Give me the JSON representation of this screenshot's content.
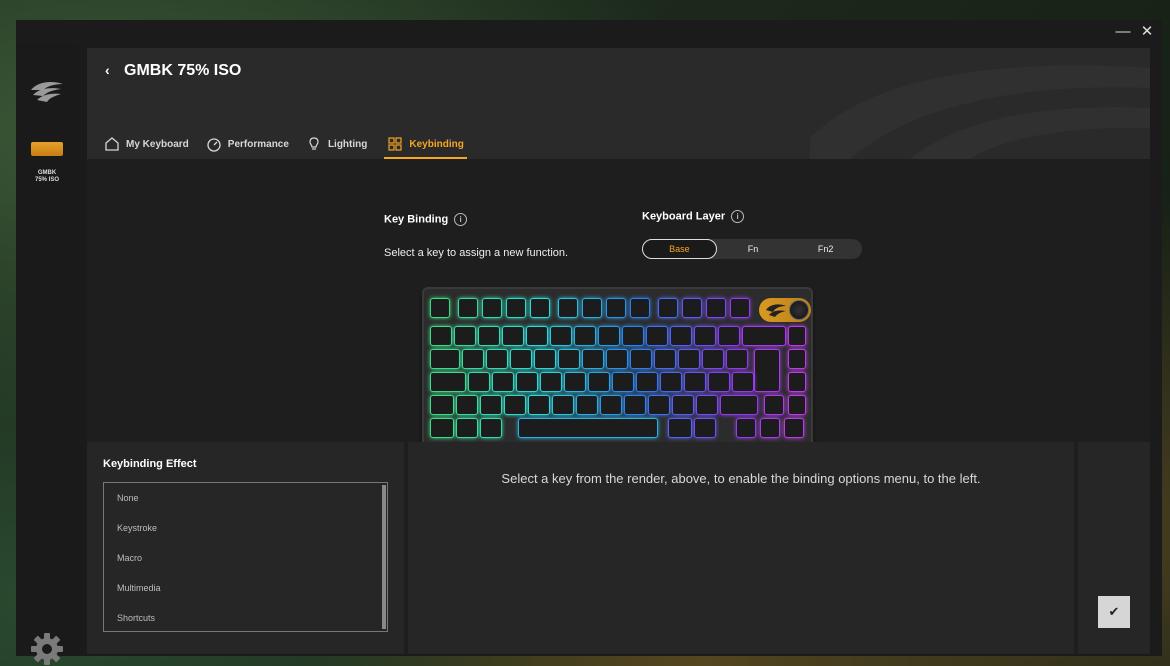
{
  "window": {
    "minimize": "—",
    "close": "✕"
  },
  "sidebar": {
    "device_label_line1": "GMBK",
    "device_label_line2": "75% ISO"
  },
  "header": {
    "back": "‹",
    "title": "GMBK 75% ISO"
  },
  "tabs": [
    {
      "label": "My Keyboard",
      "icon": "home-icon"
    },
    {
      "label": "Performance",
      "icon": "gauge-icon"
    },
    {
      "label": "Lighting",
      "icon": "bulb-icon"
    },
    {
      "label": "Keybinding",
      "icon": "keybinding-icon",
      "active": true
    }
  ],
  "key_binding": {
    "title": "Key Binding",
    "description": "Select a key to assign a new function."
  },
  "keyboard_layer": {
    "title": "Keyboard Layer",
    "options": [
      "Base",
      "Fn",
      "Fn2"
    ],
    "selected": "Base"
  },
  "effect": {
    "title": "Keybinding Effect",
    "items": [
      "None",
      "Keystroke",
      "Macro",
      "Multimedia",
      "Shortcuts"
    ]
  },
  "options": {
    "message": "Select a key from the render, above, to enable the binding options menu, to the left."
  },
  "confirm": "✔",
  "colors": {
    "accent": "#f5a623",
    "panel": "#262626",
    "background": "#1e1e1e"
  }
}
